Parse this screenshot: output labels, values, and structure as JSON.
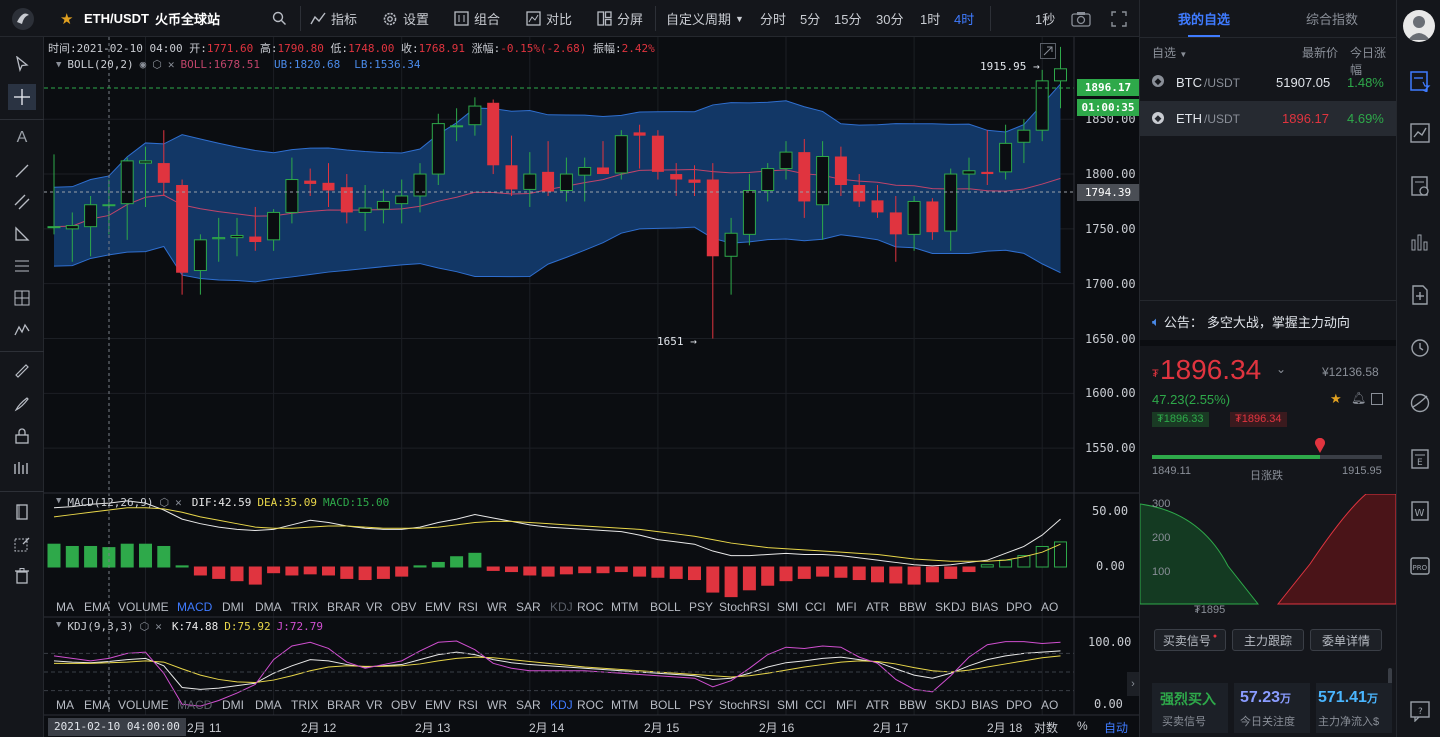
{
  "topbar": {
    "symbol": "ETH/USDT",
    "exchange": "火币全球站",
    "indicators_label": "指标",
    "settings_label": "设置",
    "combo_label": "组合",
    "compare_label": "对比",
    "split_label": "分屏",
    "custom_period_label": "自定义周期",
    "periods": [
      "分时",
      "5分",
      "15分",
      "30分",
      "1时",
      "4时"
    ],
    "active_period": "4时",
    "refresh_label": "1秒"
  },
  "ohlc_bar": {
    "time_label": "时间:",
    "time": "2021-02-10 04:00",
    "open_label": "开:",
    "open": "1771.60",
    "high_label": "高:",
    "high": "1790.80",
    "low_label": "低:",
    "low": "1748.00",
    "close_label": "收:",
    "close": "1768.91",
    "change_label": "涨幅:",
    "change": "-0.15%(-2.68)",
    "amp_label": "振幅:",
    "amp": "2.42%"
  },
  "boll": {
    "name": "BOLL(20,2)",
    "mid": "BOLL:1678.51",
    "up": "UB:1820.68",
    "low": "LB:1536.34"
  },
  "macd": {
    "name": "MACD(12,26,9)",
    "dif": "DIF:42.59",
    "dea": "DEA:35.09",
    "macd": "MACD:15.00"
  },
  "kdj": {
    "name": "KDJ(9,3,3)",
    "k": "K:74.88",
    "d": "D:75.92",
    "j": "J:72.79"
  },
  "price_axis": [
    "1850.00",
    "1800.00",
    "1750.00",
    "1700.00",
    "1650.00",
    "1600.00",
    "1550.00"
  ],
  "price_tags": {
    "last": "1896.17",
    "countdown": "01:00:35",
    "cross": "1794.39"
  },
  "annotations": {
    "high": "1915.95",
    "low": "1651"
  },
  "macd_axis": [
    "50.00",
    "0.00"
  ],
  "kdj_axis": [
    "100.00",
    "0.00"
  ],
  "indicator_tabs": [
    "MA",
    "EMA",
    "VOLUME",
    "MACD",
    "DMI",
    "DMA",
    "TRIX",
    "BRAR",
    "VR",
    "OBV",
    "EMV",
    "RSI",
    "WR",
    "SAR",
    "KDJ",
    "ROC",
    "MTM",
    "BOLL",
    "PSY",
    "StochRSI",
    "SMI",
    "CCI",
    "MFI",
    "ATR",
    "BBW",
    "SKDJ",
    "BIAS",
    "DPO",
    "AO"
  ],
  "time_axis": {
    "cursor": "2021-02-10 04:00:00",
    "labels": [
      "2月 11",
      "2月 12",
      "2月 13",
      "2月 14",
      "2月 15",
      "2月 16",
      "2月 17",
      "2月 18"
    ],
    "log_label": "对数",
    "pct_label": "%",
    "auto_label": "自动"
  },
  "watchlist": {
    "tab_mine": "我的自选",
    "tab_index": "综合指数",
    "filter_label": "自选",
    "col_price": "最新价",
    "col_change": "今日涨幅",
    "rows": [
      {
        "base": "BTC",
        "quote": "/USDT",
        "price": "51907.05",
        "change": "1.48%"
      },
      {
        "base": "ETH",
        "quote": "/USDT",
        "price": "1896.17",
        "change": "4.69%"
      }
    ]
  },
  "notice": {
    "label": "公告：",
    "text": "多空大战，掌握主力动向"
  },
  "quote": {
    "price": "1896.34",
    "cny": "¥12136.58",
    "change": "47.23(2.55%)",
    "bid": "1896.33",
    "ask": "1896.34",
    "range_low": "1849.11",
    "range_high": "1915.95",
    "range_label": "日涨跌",
    "range_position": 0.73,
    "depth_labels": [
      "300",
      "200",
      "100"
    ],
    "depth_price": "1895"
  },
  "bottom_buttons": [
    "买卖信号",
    "主力跟踪",
    "委单详情"
  ],
  "stats": {
    "signal": "强烈买入",
    "signal_label": "买卖信号",
    "attention": "57.23",
    "attention_unit": "万",
    "attention_label": "今日关注度",
    "inflow": "571.41",
    "inflow_unit": "万",
    "inflow_label": "主力净流入$"
  },
  "colors": {
    "up": "#2ea94a",
    "down": "#e0343f",
    "accent": "#3f7bff",
    "band": "#123766"
  },
  "chart_data": {
    "type": "candlestick",
    "interval": "4h",
    "candles": [
      [
        1752,
        1818,
        1745,
        1752
      ],
      [
        1750,
        1765,
        1720,
        1753
      ],
      [
        1752,
        1780,
        1725,
        1772
      ],
      [
        1772,
        1795,
        1745,
        1772
      ],
      [
        1773,
        1815,
        1740,
        1812
      ],
      [
        1810,
        1825,
        1770,
        1812
      ],
      [
        1810,
        1840,
        1780,
        1792
      ],
      [
        1790,
        1795,
        1690,
        1710
      ],
      [
        1712,
        1745,
        1690,
        1740
      ],
      [
        1741,
        1760,
        1720,
        1742
      ],
      [
        1742,
        1760,
        1725,
        1744
      ],
      [
        1743,
        1770,
        1730,
        1738
      ],
      [
        1740,
        1768,
        1730,
        1765
      ],
      [
        1765,
        1815,
        1755,
        1795
      ],
      [
        1794,
        1805,
        1780,
        1791
      ],
      [
        1792,
        1810,
        1770,
        1785
      ],
      [
        1788,
        1800,
        1755,
        1765
      ],
      [
        1765,
        1790,
        1748,
        1769
      ],
      [
        1768,
        1786,
        1755,
        1775
      ],
      [
        1773,
        1795,
        1755,
        1780
      ],
      [
        1780,
        1810,
        1765,
        1800
      ],
      [
        1800,
        1855,
        1790,
        1846
      ],
      [
        1844,
        1860,
        1830,
        1844
      ],
      [
        1845,
        1870,
        1835,
        1862
      ],
      [
        1865,
        1868,
        1800,
        1808
      ],
      [
        1808,
        1835,
        1780,
        1786
      ],
      [
        1786,
        1820,
        1770,
        1800
      ],
      [
        1802,
        1830,
        1780,
        1784
      ],
      [
        1785,
        1815,
        1775,
        1800
      ],
      [
        1799,
        1815,
        1775,
        1806
      ],
      [
        1806,
        1830,
        1800,
        1800
      ],
      [
        1801,
        1840,
        1795,
        1835
      ],
      [
        1838,
        1845,
        1805,
        1835
      ],
      [
        1835,
        1840,
        1795,
        1802
      ],
      [
        1800,
        1810,
        1780,
        1795
      ],
      [
        1795,
        1808,
        1780,
        1792
      ],
      [
        1795,
        1810,
        1650,
        1725
      ],
      [
        1725,
        1760,
        1690,
        1746
      ],
      [
        1745,
        1800,
        1735,
        1785
      ],
      [
        1785,
        1810,
        1775,
        1805
      ],
      [
        1805,
        1830,
        1795,
        1820
      ],
      [
        1820,
        1832,
        1760,
        1775
      ],
      [
        1772,
        1830,
        1740,
        1816
      ],
      [
        1816,
        1825,
        1780,
        1790
      ],
      [
        1790,
        1800,
        1770,
        1775
      ],
      [
        1776,
        1790,
        1760,
        1765
      ],
      [
        1765,
        1780,
        1720,
        1745
      ],
      [
        1745,
        1780,
        1730,
        1775
      ],
      [
        1775,
        1778,
        1740,
        1747
      ],
      [
        1748,
        1805,
        1730,
        1800
      ],
      [
        1800,
        1815,
        1785,
        1803
      ],
      [
        1802,
        1840,
        1790,
        1800
      ],
      [
        1802,
        1845,
        1795,
        1828
      ],
      [
        1829,
        1850,
        1810,
        1840
      ],
      [
        1840,
        1895,
        1830,
        1885
      ],
      [
        1885,
        1916,
        1860,
        1896
      ]
    ],
    "price_range": [
      1510,
      1925
    ],
    "macd_hist": [
      20,
      18,
      18,
      17,
      20,
      20,
      18,
      1,
      -7,
      -10,
      -12,
      -15,
      -5,
      -7,
      -6,
      -7,
      -10,
      -11,
      -10,
      -8,
      1,
      4,
      9,
      12,
      -3,
      -4,
      -7,
      -8,
      -6,
      -5,
      -5,
      -4,
      -8,
      -9,
      -10,
      -11,
      -22,
      -26,
      -20,
      -16,
      -12,
      -10,
      -8,
      -9,
      -11,
      -13,
      -14,
      -15,
      -13,
      -10,
      -4,
      2,
      6,
      10,
      18,
      22
    ],
    "dif": [
      52,
      53,
      55,
      56,
      58,
      56,
      50,
      42,
      38,
      35,
      33,
      32,
      33,
      37,
      41,
      39,
      36,
      34,
      33,
      33,
      35,
      39,
      42,
      46,
      43,
      40,
      37,
      35,
      34,
      33,
      32,
      31,
      28,
      24,
      22,
      20,
      14,
      10,
      10,
      11,
      12,
      11,
      11,
      10,
      8,
      6,
      4,
      2,
      1,
      2,
      4,
      6,
      12,
      18,
      28,
      42
    ],
    "dea": [
      44,
      46,
      48,
      50,
      52,
      52,
      51,
      48,
      44,
      41,
      38,
      35,
      34,
      34,
      35,
      36,
      36,
      35,
      34,
      34,
      34,
      35,
      37,
      39,
      40,
      40,
      39,
      38,
      37,
      36,
      35,
      34,
      33,
      31,
      29,
      27,
      24,
      21,
      19,
      17,
      16,
      15,
      14,
      13,
      12,
      11,
      9,
      7,
      6,
      5,
      5,
      5,
      6,
      9,
      13,
      20
    ],
    "kdj_k": [
      68,
      66,
      65,
      67,
      70,
      72,
      60,
      25,
      22,
      24,
      28,
      32,
      48,
      60,
      70,
      68,
      62,
      58,
      60,
      62,
      70,
      78,
      82,
      78,
      70,
      65,
      62,
      60,
      58,
      56,
      54,
      52,
      50,
      48,
      46,
      44,
      38,
      40,
      48,
      58,
      65,
      68,
      72,
      74,
      70,
      66,
      55,
      45,
      40,
      48,
      60,
      70,
      76,
      80,
      82,
      84
    ],
    "kdj_d": [
      64,
      64,
      64,
      65,
      66,
      68,
      66,
      55,
      45,
      38,
      34,
      33,
      37,
      44,
      52,
      58,
      60,
      59,
      59,
      60,
      63,
      68,
      72,
      74,
      73,
      70,
      67,
      64,
      61,
      58,
      56,
      54,
      52,
      50,
      48,
      46,
      44,
      42,
      44,
      48,
      53,
      58,
      62,
      66,
      68,
      67,
      63,
      57,
      52,
      50,
      53,
      58,
      63,
      68,
      73,
      76
    ],
    "kdj_j": [
      76,
      72,
      68,
      72,
      80,
      82,
      48,
      -2,
      -5,
      4,
      16,
      30,
      70,
      92,
      98,
      88,
      66,
      56,
      62,
      68,
      84,
      98,
      100,
      86,
      64,
      56,
      52,
      52,
      52,
      52,
      50,
      48,
      46,
      44,
      42,
      40,
      26,
      36,
      56,
      78,
      90,
      88,
      92,
      90,
      74,
      64,
      38,
      22,
      18,
      44,
      74,
      94,
      99,
      99,
      96,
      98
    ]
  }
}
